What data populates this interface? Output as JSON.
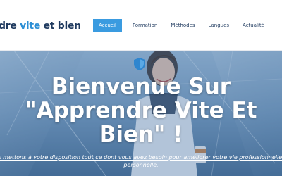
{
  "header": {
    "logo_text_1": "dre ",
    "logo_text_2": "vite",
    "logo_text_3": " et bien",
    "nav": [
      {
        "label": "Accueil"
      },
      {
        "label": "Formation"
      },
      {
        "label": "Méthodes"
      },
      {
        "label": "Langues"
      },
      {
        "label": "Actualité"
      }
    ]
  },
  "hero": {
    "title": "Bienvenue Sur \"Apprendre Vite Et Bien\" !",
    "subtitle": "us mettons à votre disposition tout ce dont vous avez besoin pour améliorer votre vie professionnelle e personnelle."
  },
  "colors": {
    "brand_dark": "#1f3a5f",
    "brand_accent": "#3a9be0"
  },
  "icons": {
    "hero_icon": "shield-icon"
  }
}
